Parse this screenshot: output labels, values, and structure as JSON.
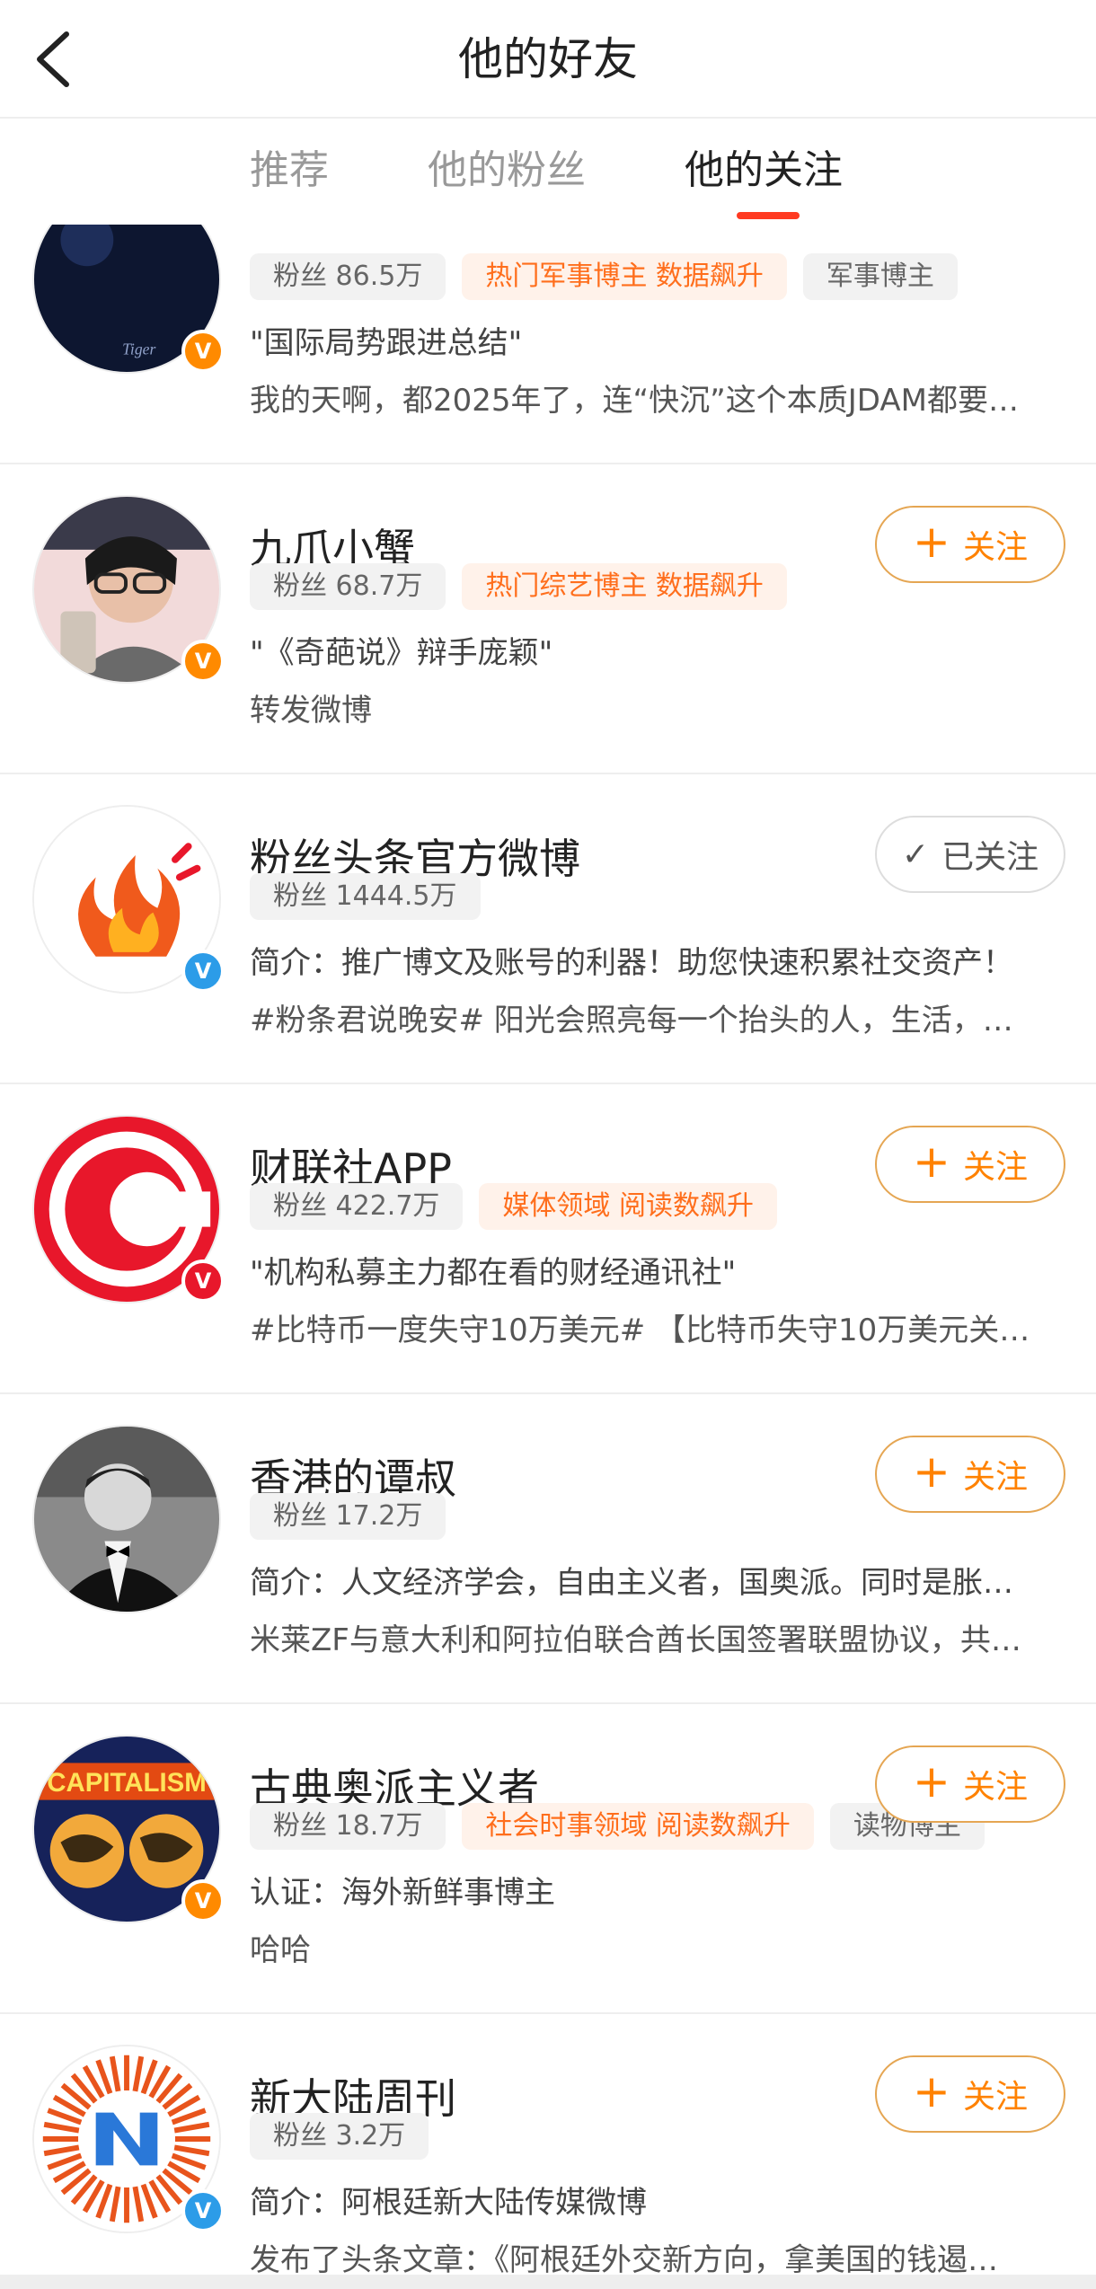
{
  "header": {
    "title": "他的好友"
  },
  "tabs": [
    {
      "label": "推荐",
      "active": false
    },
    {
      "label": "他的粉丝",
      "active": false
    },
    {
      "label": "他的关注",
      "active": true
    }
  ],
  "colors": {
    "accent": "#ff8200",
    "tab_indicator": "#ff3a21",
    "hot_tag_bg": "#fff2ea",
    "hot_tag_text": "#ff6e1c"
  },
  "users": [
    {
      "name": "",
      "badge": "orange",
      "tags": [
        {
          "text": "粉丝 86.5万",
          "style": "gray"
        },
        {
          "text": "热门军事博主 数据飙升",
          "style": "hot"
        },
        {
          "text": "军事博主",
          "style": "gray"
        }
      ],
      "line1": "\"国际局势跟进总结\"",
      "line2": "我的天啊，都2025年了，连“快沉”这个本质JDAM都要…",
      "follow": "none"
    },
    {
      "name": "九爪小蟹",
      "badge": "orange",
      "tags": [
        {
          "text": "粉丝 68.7万",
          "style": "gray"
        },
        {
          "text": "热门综艺博主 数据飙升",
          "style": "hot"
        }
      ],
      "line1": "\"《奇葩说》辩手庞颖\"",
      "line2": "转发微博",
      "follow": "关注"
    },
    {
      "name": "粉丝头条官方微博",
      "badge": "blue",
      "tags": [
        {
          "text": "粉丝 1444.5万",
          "style": "gray"
        }
      ],
      "line1": "简介：推广博文及账号的利器！助您快速积累社交资产！",
      "line2": "#粉条君说晚安# 阳光会照亮每一个抬头的人，生活，…",
      "follow": "已关注"
    },
    {
      "name": "财联社APP",
      "badge": "red",
      "tags": [
        {
          "text": "粉丝 422.7万",
          "style": "gray"
        },
        {
          "text": "媒体领域 阅读数飙升",
          "style": "hot"
        }
      ],
      "line1": "\"机构私募主力都在看的财经通讯社\"",
      "line2": "#比特币一度失守10万美元# 【比特币失守10万美元关…",
      "follow": "关注"
    },
    {
      "name": "香港的谭叔",
      "badge": "none",
      "tags": [
        {
          "text": "粉丝 17.2万",
          "style": "gray"
        }
      ],
      "line1": "简介：人文经济学会，自由主义者，国奥派。同时是胀…",
      "line2": "米莱ZF与意大利和阿拉伯联合酋长国签署联盟协议，共…",
      "follow": "关注"
    },
    {
      "name": "古典奥派主义者",
      "badge": "orange",
      "tags": [
        {
          "text": "粉丝 18.7万",
          "style": "gray"
        },
        {
          "text": "社会时事领域 阅读数飙升",
          "style": "hot"
        },
        {
          "text": "读物博主",
          "style": "gray"
        }
      ],
      "line1": "认证：海外新鲜事博主",
      "line2": "哈哈",
      "follow": "关注"
    },
    {
      "name": "新大陆周刊",
      "badge": "blue",
      "tags": [
        {
          "text": "粉丝 3.2万",
          "style": "gray"
        }
      ],
      "line1": "简介：阿根廷新大陆传媒微博",
      "line2": "发布了头条文章：《阿根廷外交新方向，拿美国的钱遏…",
      "follow": "关注"
    }
  ],
  "avatar_texts": {
    "capitalism": "CAPITALISM",
    "tiger": "Tiger"
  },
  "badge_letter": "V",
  "plus_icon": "+",
  "check_icon": "✓"
}
